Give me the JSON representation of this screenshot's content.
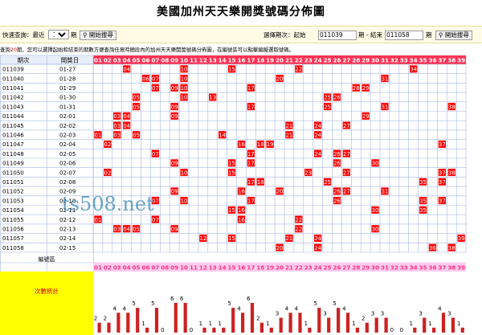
{
  "header": {
    "title": "美國加州天天樂開獎號碼分佈圖"
  },
  "query": {
    "quick_label": "快速查詢：最近",
    "count_value": "10",
    "count_options": [
      "10"
    ],
    "period_label": "期",
    "search_button": "開始搜尋",
    "range_label": "選擇期次：起始",
    "start_value": "011039",
    "end_label": "期 - 結束",
    "end_value": "011058",
    "period_suffix": "期",
    "search_button2": "開始搜尋"
  },
  "info": {
    "prefix": "查詢",
    "count": "20",
    "suffix": "期，您可以選擇起始和結束的期數方便查詢任意時間段內的加州天天樂開獎號碼分佈圖，在編號區可以點擊編擬選取號碼。"
  },
  "table": {
    "col_period": "期次",
    "col_date": "開獎日",
    "numbers": [
      "01",
      "02",
      "03",
      "04",
      "05",
      "06",
      "07",
      "08",
      "09",
      "10",
      "11",
      "12",
      "13",
      "14",
      "15",
      "16",
      "17",
      "18",
      "19",
      "20",
      "21",
      "22",
      "23",
      "24",
      "25",
      "26",
      "27",
      "28",
      "29",
      "30",
      "31",
      "32",
      "33",
      "34",
      "35",
      "36",
      "37",
      "38",
      "39"
    ],
    "rows": [
      {
        "p": "011039",
        "d": "01-27",
        "n": [
          4,
          10,
          15,
          22,
          34
        ]
      },
      {
        "p": "011040",
        "d": "01-28",
        "n": [
          6,
          7,
          10,
          20,
          31
        ]
      },
      {
        "p": "011041",
        "d": "01-29",
        "n": [
          7,
          9,
          10,
          17,
          28,
          29
        ]
      },
      {
        "p": "011042",
        "d": "01-30",
        "n": [
          5,
          10,
          13,
          25,
          26
        ]
      },
      {
        "p": "011043",
        "d": "01-31",
        "n": [
          5,
          9,
          17,
          25,
          31,
          38
        ]
      },
      {
        "p": "011044",
        "d": "02-01",
        "n": [
          3,
          4,
          9,
          29
        ]
      },
      {
        "p": "011045",
        "d": "02-02",
        "n": [
          3,
          4,
          21,
          24,
          27
        ]
      },
      {
        "p": "011046",
        "d": "02-03",
        "n": [
          1,
          3,
          5,
          14,
          21,
          24
        ]
      },
      {
        "p": "011047",
        "d": "02-04",
        "n": [
          2,
          16,
          18,
          19,
          37
        ]
      },
      {
        "p": "011048",
        "d": "02-05",
        "n": [
          7,
          17,
          24,
          26,
          27
        ]
      },
      {
        "p": "011049",
        "d": "02-06",
        "n": [
          9,
          15,
          17,
          26,
          30
        ]
      },
      {
        "p": "011050",
        "d": "02-07",
        "n": [
          2,
          10,
          15,
          23,
          27,
          37,
          38
        ]
      },
      {
        "p": "011051",
        "d": "02-08",
        "n": [
          17,
          18,
          25,
          35,
          37
        ]
      },
      {
        "p": "011052",
        "d": "02-09",
        "n": [
          9,
          16,
          20,
          26,
          27,
          31
        ]
      },
      {
        "p": "011053",
        "d": "02-10",
        "n": [
          7,
          10,
          17,
          26,
          35,
          37
        ]
      },
      {
        "p": "011054",
        "d": "02-11",
        "n": [
          15,
          16,
          30,
          35
        ]
      },
      {
        "p": "011055",
        "d": "02-12",
        "n": [
          1,
          7,
          16,
          22
        ]
      },
      {
        "p": "011056",
        "d": "02-13",
        "n": [
          3,
          4,
          5,
          9,
          22,
          30
        ]
      },
      {
        "p": "011057",
        "d": "02-14",
        "n": [
          12,
          15,
          21,
          24,
          39
        ]
      },
      {
        "p": "011058",
        "d": "02-15",
        "n": [
          20,
          24,
          36,
          38
        ]
      }
    ],
    "footer_label": "編號區",
    "stats_label": "次數統計",
    "watermark": "ts508.net"
  },
  "chart_data": {
    "type": "bar",
    "categories": [
      "01",
      "02",
      "03",
      "04",
      "05",
      "06",
      "07",
      "08",
      "09",
      "10",
      "11",
      "12",
      "13",
      "14",
      "15",
      "16",
      "17",
      "18",
      "19",
      "20",
      "21",
      "22",
      "23",
      "24",
      "25",
      "26",
      "27",
      "28",
      "29",
      "30",
      "31",
      "32",
      "33",
      "34",
      "35",
      "36",
      "37",
      "38",
      "39"
    ],
    "values": [
      2,
      2,
      4,
      4,
      5,
      1,
      5,
      0,
      6,
      6,
      0,
      1,
      1,
      1,
      5,
      4,
      6,
      2,
      1,
      3,
      4,
      4,
      1,
      5,
      3,
      5,
      4,
      1,
      2,
      3,
      3,
      0,
      0,
      1,
      3,
      1,
      4,
      3,
      1
    ],
    "colors": {
      "bar": "#cc2222",
      "grid_line": "#a8b8e0",
      "number_header": "#ff3355",
      "footer_bg": "#ffccee",
      "highlight": "#ff0000",
      "stats_bg": "#ffff00",
      "stats_text": "#cc0000"
    }
  }
}
